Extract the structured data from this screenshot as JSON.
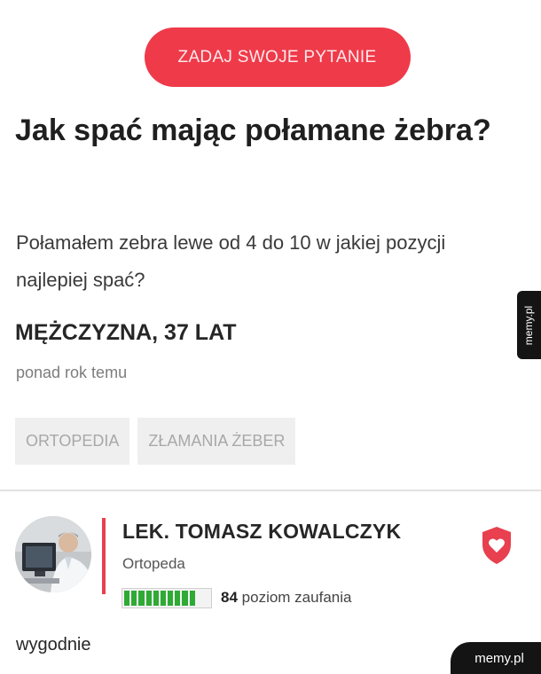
{
  "ask_button": {
    "label": "ZADAJ SWOJE PYTANIE",
    "color": "#ef3a4a"
  },
  "question": {
    "title": "Jak spać mając połamane żebra?",
    "body": "Połamałem zebra lewe od 4 do 10 w jakiej pozycji najlepiej spać?",
    "author": "MĘŻCZYZNA, 37 LAT",
    "time": "ponad rok temu",
    "tags": [
      "ORTOPEDIA",
      "ZŁAMANIA ŻEBER"
    ]
  },
  "answer": {
    "doctor_name": "LEK. TOMASZ KOWALCZYK",
    "specialty": "Ortopeda",
    "trust_value": "84",
    "trust_label": "poziom zaufania",
    "trust_fraction": 0.84,
    "trust_color": "#2faa35",
    "accent_color": "#e8404f",
    "avatar_icon": "doctor-avatar",
    "badge_icon": "shield-heart-icon",
    "text": "wygodnie"
  },
  "watermarks": {
    "side": "memy.pl",
    "corner": "memy.pl"
  }
}
